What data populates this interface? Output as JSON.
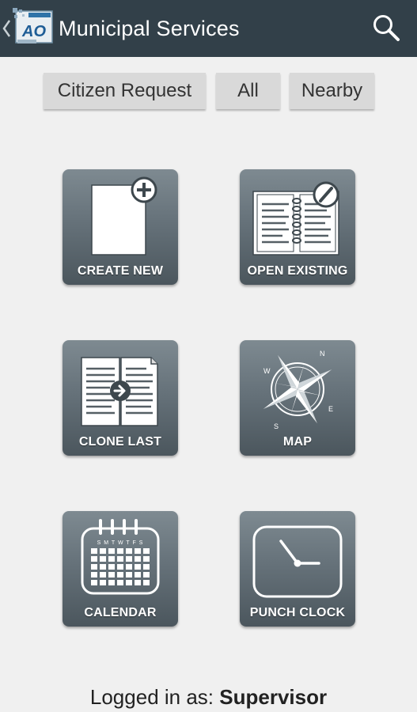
{
  "header": {
    "title": "Municipal Services",
    "logo_text": "AO",
    "icons": [
      "back-chevron-icon",
      "app-logo-icon",
      "search-icon"
    ]
  },
  "filters": [
    {
      "label": "Citizen Request"
    },
    {
      "label": "All"
    },
    {
      "label": "Nearby"
    }
  ],
  "tiles": [
    {
      "label": "CREATE NEW",
      "icon": "document-add-icon"
    },
    {
      "label": "OPEN EXISTING",
      "icon": "open-book-edit-icon"
    },
    {
      "label": "CLONE LAST",
      "icon": "document-clone-icon"
    },
    {
      "label": "MAP",
      "icon": "compass-rose-icon"
    },
    {
      "label": "CALENDAR",
      "icon": "calendar-icon"
    },
    {
      "label": "PUNCH CLOCK",
      "icon": "clock-icon"
    }
  ],
  "compass": {
    "n": "N",
    "e": "E",
    "s": "S",
    "w": "W"
  },
  "calendar_days": "S M T W T F S",
  "footer": {
    "prefix": "Logged in as:",
    "user": "Supervisor"
  },
  "colors": {
    "actionbar": "#324049",
    "background": "#f0f0f0",
    "tile_top": "#7e8a91",
    "tile_bottom": "#4b565d",
    "filter_button": "#d9d9d9"
  }
}
